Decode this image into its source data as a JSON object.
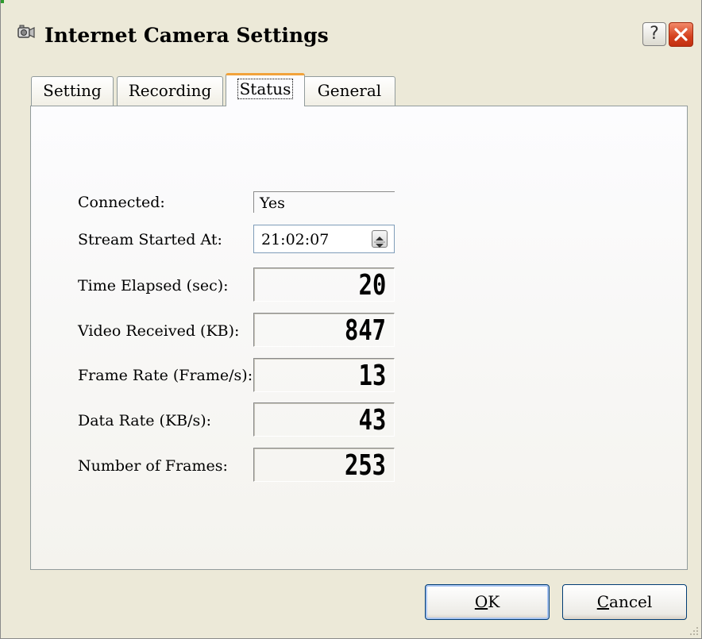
{
  "window": {
    "title": "Internet Camera Settings",
    "help_label": "?"
  },
  "tabs": [
    {
      "label": "Setting",
      "active": false
    },
    {
      "label": "Recording",
      "active": false
    },
    {
      "label": "Status",
      "active": true
    },
    {
      "label": "General",
      "active": false
    }
  ],
  "status": {
    "connected": {
      "label": "Connected:",
      "value": "Yes"
    },
    "stream_started": {
      "label": "Stream Started At:",
      "value": "21:02:07"
    },
    "time_elapsed": {
      "label": "Time Elapsed (sec):",
      "value": "20"
    },
    "video_received": {
      "label": "Video Received (KB):",
      "value": "847"
    },
    "frame_rate": {
      "label": "Frame Rate (Frame/s):",
      "value": "13"
    },
    "data_rate": {
      "label": "Data Rate (KB/s):",
      "value": "43"
    },
    "number_of_frames": {
      "label": "Number of Frames:",
      "value": "253"
    }
  },
  "buttons": {
    "ok": {
      "accel": "O",
      "rest": "K"
    },
    "cancel": {
      "accel": "C",
      "rest": "ancel"
    }
  },
  "icons": {
    "title": "camera-icon",
    "close": "close-icon",
    "spin": "spin-up-down-icon",
    "grip": "resize-grip-icon"
  },
  "colors": {
    "active_tab_accent": "#f2a33b",
    "close_button": "#d4401c",
    "window_bg": "#ece9d8"
  }
}
